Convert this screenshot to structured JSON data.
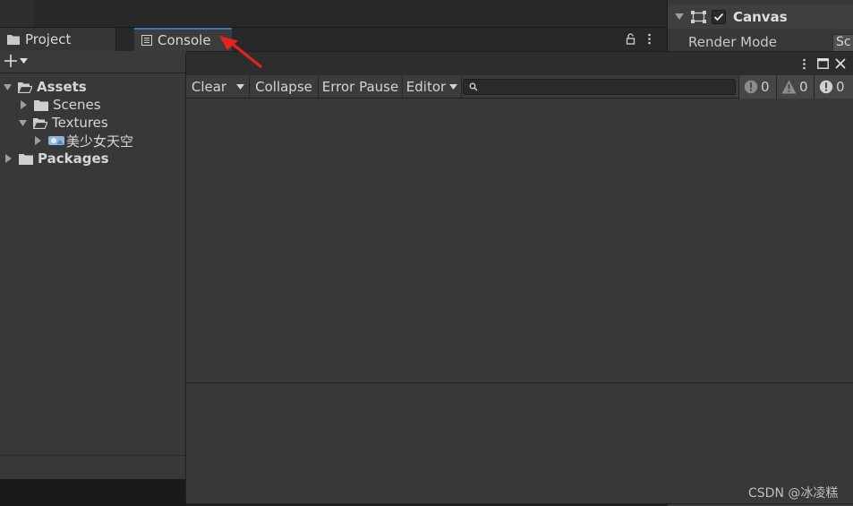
{
  "tabs": {
    "project": "Project",
    "console": "Console"
  },
  "project": {
    "tree": [
      {
        "label": "Assets",
        "expanded": true,
        "bold": true
      },
      {
        "label": "Scenes",
        "expanded": false,
        "bold": false
      },
      {
        "label": "Textures",
        "expanded": true,
        "bold": false
      },
      {
        "label": "美少女天空",
        "expanded": false,
        "bold": false
      },
      {
        "label": "Packages",
        "expanded": false,
        "bold": true
      }
    ]
  },
  "inspector": {
    "component": "Canvas",
    "enabled": true,
    "render_mode_label": "Render Mode",
    "render_mode_value": "Sc"
  },
  "console": {
    "toolbar": {
      "clear": "Clear",
      "collapse": "Collapse",
      "error_pause": "Error Pause",
      "editor": "Editor"
    },
    "search_placeholder": "",
    "counts": {
      "info": "0",
      "warnings": "0",
      "errors": "0"
    }
  },
  "watermark": "CSDN @冰凌糕",
  "colors": {
    "accent": "#3a79bb",
    "arrow": "#e52222"
  },
  "icons": [
    "folder-icon",
    "console-icon",
    "lock-icon",
    "kebab-menu-icon",
    "plus-icon",
    "chevron-down-icon",
    "triangle-right-icon",
    "triangle-down-icon",
    "folder-open-icon",
    "image-icon",
    "rect-transform-icon",
    "checkbox-icon",
    "maximize-icon",
    "close-icon",
    "search-icon",
    "info-icon",
    "warning-icon",
    "error-icon",
    "red-arrow-annotation"
  ]
}
